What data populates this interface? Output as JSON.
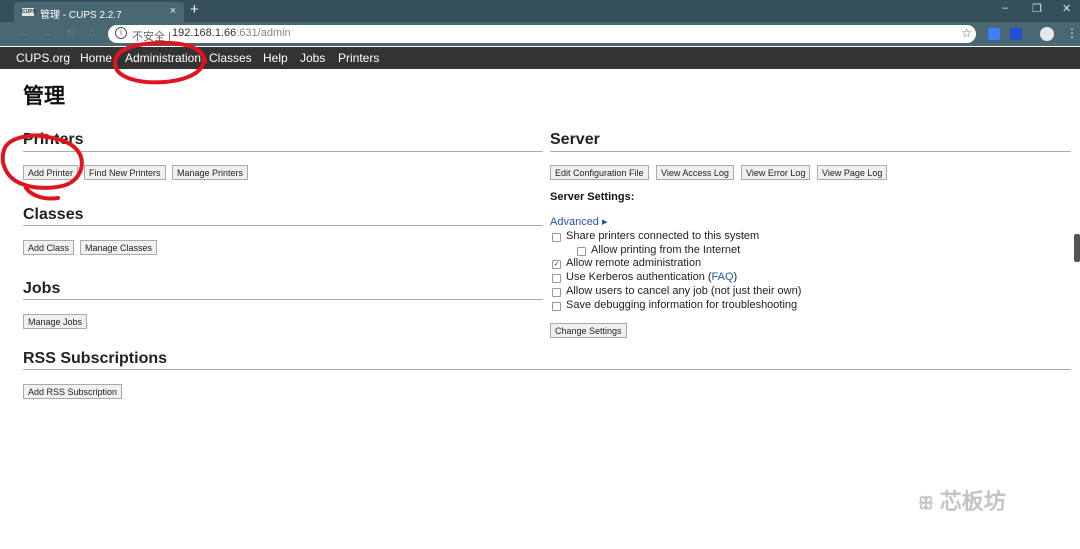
{
  "browser": {
    "tab": {
      "favicon_text": "CUPS",
      "title": "管理 - CUPS 2.2.7",
      "close": "×"
    },
    "new_tab": "+",
    "window_controls": {
      "minimize": "–",
      "restore": "❐",
      "close": "✕"
    },
    "nav": {
      "back": "←",
      "forward": "→",
      "reload": "↻",
      "home": "⌂"
    },
    "address_bar": {
      "info_icon": "i",
      "insecure_label": "不安全 |",
      "host": "192.168.1.66",
      "port_path": ":631/admin"
    },
    "bookmark_star": "☆"
  },
  "cups_nav": {
    "items": [
      "CUPS.org",
      "Home",
      "Administration",
      "Classes",
      "Help",
      "Jobs",
      "Printers"
    ]
  },
  "page": {
    "title": "管理",
    "sections": {
      "printers": {
        "heading": "Printers",
        "buttons": [
          "Add Printer",
          "Find New Printers",
          "Manage Printers"
        ]
      },
      "classes": {
        "heading": "Classes",
        "buttons": [
          "Add Class",
          "Manage Classes"
        ]
      },
      "jobs": {
        "heading": "Jobs",
        "buttons": [
          "Manage Jobs"
        ]
      },
      "rss": {
        "heading": "RSS Subscriptions",
        "buttons": [
          "Add RSS Subscription"
        ]
      },
      "server": {
        "heading": "Server",
        "buttons": [
          "Edit Configuration File",
          "View Access Log",
          "View Error Log",
          "View Page Log"
        ],
        "settings_title": "Server Settings:",
        "advanced_label": "Advanced ▸",
        "options": [
          {
            "label": "Share printers connected to this system",
            "checked": false
          },
          {
            "label": "Allow printing from the Internet",
            "checked": false
          },
          {
            "label": "Allow remote administration",
            "checked": true
          },
          {
            "label": "Use Kerberos authentication (",
            "link": "FAQ",
            "suffix": ")",
            "checked": false
          },
          {
            "label": "Allow users to cancel any job (not just their own)",
            "checked": false
          },
          {
            "label": "Save debugging information for troubleshooting",
            "checked": false
          }
        ],
        "change_button": "Change Settings"
      }
    }
  },
  "watermark": {
    "icon": "ꕥ",
    "text": "芯板坊"
  },
  "colors": {
    "tab_strip": "#35505a",
    "toolbar": "#4a6873",
    "cups_nav": "#333333",
    "link": "#2255aa",
    "annotation": "#e0141e"
  }
}
